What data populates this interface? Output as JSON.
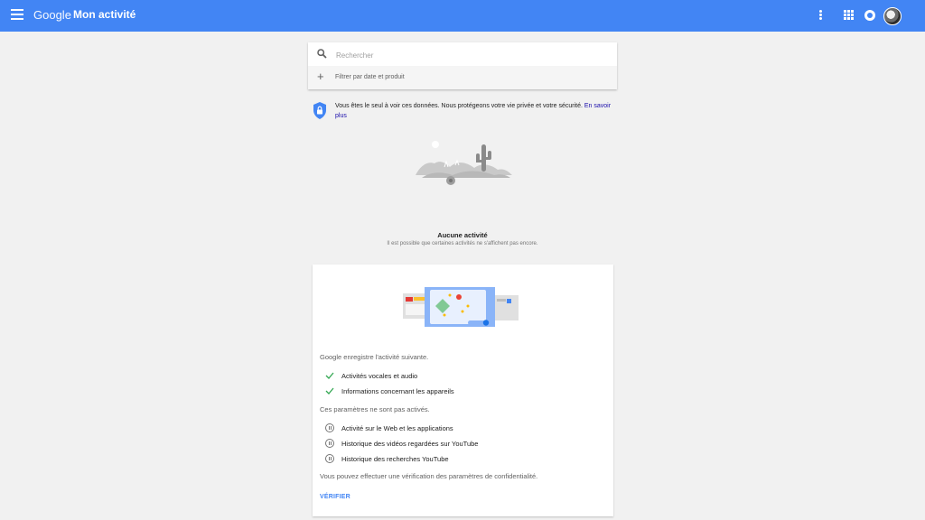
{
  "header": {
    "brand": "Google",
    "title": "Mon activité",
    "accent_color": "#4285f4",
    "icons": [
      "menu-icon",
      "more-vert-icon",
      "apps-icon",
      "notifications-icon",
      "avatar"
    ]
  },
  "search": {
    "placeholder": "Rechercher",
    "value": "",
    "filter_label": "Filtrer par date et produit"
  },
  "privacy": {
    "text": "Vous êtes le seul à voir ces données. Nous protégeons votre vie privée et votre sécurité.",
    "link": "En savoir plus"
  },
  "empty_state": {
    "title": "Aucune activité",
    "subtitle": "Il est possible que certaines activités ne s'affichent pas encore."
  },
  "settings_card": {
    "enabled_intro": "Google enregistre l'activité suivante.",
    "enabled_items": [
      {
        "label": "Activités vocales et audio",
        "icon": "check-icon"
      },
      {
        "label": "Informations concernant les appareils",
        "icon": "check-icon"
      }
    ],
    "disabled_intro": "Ces paramètres ne sont pas activés.",
    "disabled_items": [
      {
        "label": "Activité sur le Web et les applications",
        "icon": "pause-icon"
      },
      {
        "label": "Historique des vidéos regardées sur YouTube",
        "icon": "pause-icon"
      },
      {
        "label": "Historique des recherches YouTube",
        "icon": "pause-icon"
      }
    ],
    "footer_text": "Vous pouvez effectuer une vérification des paramètres de confidentialité.",
    "verify_label": "VÉRIFIER"
  }
}
